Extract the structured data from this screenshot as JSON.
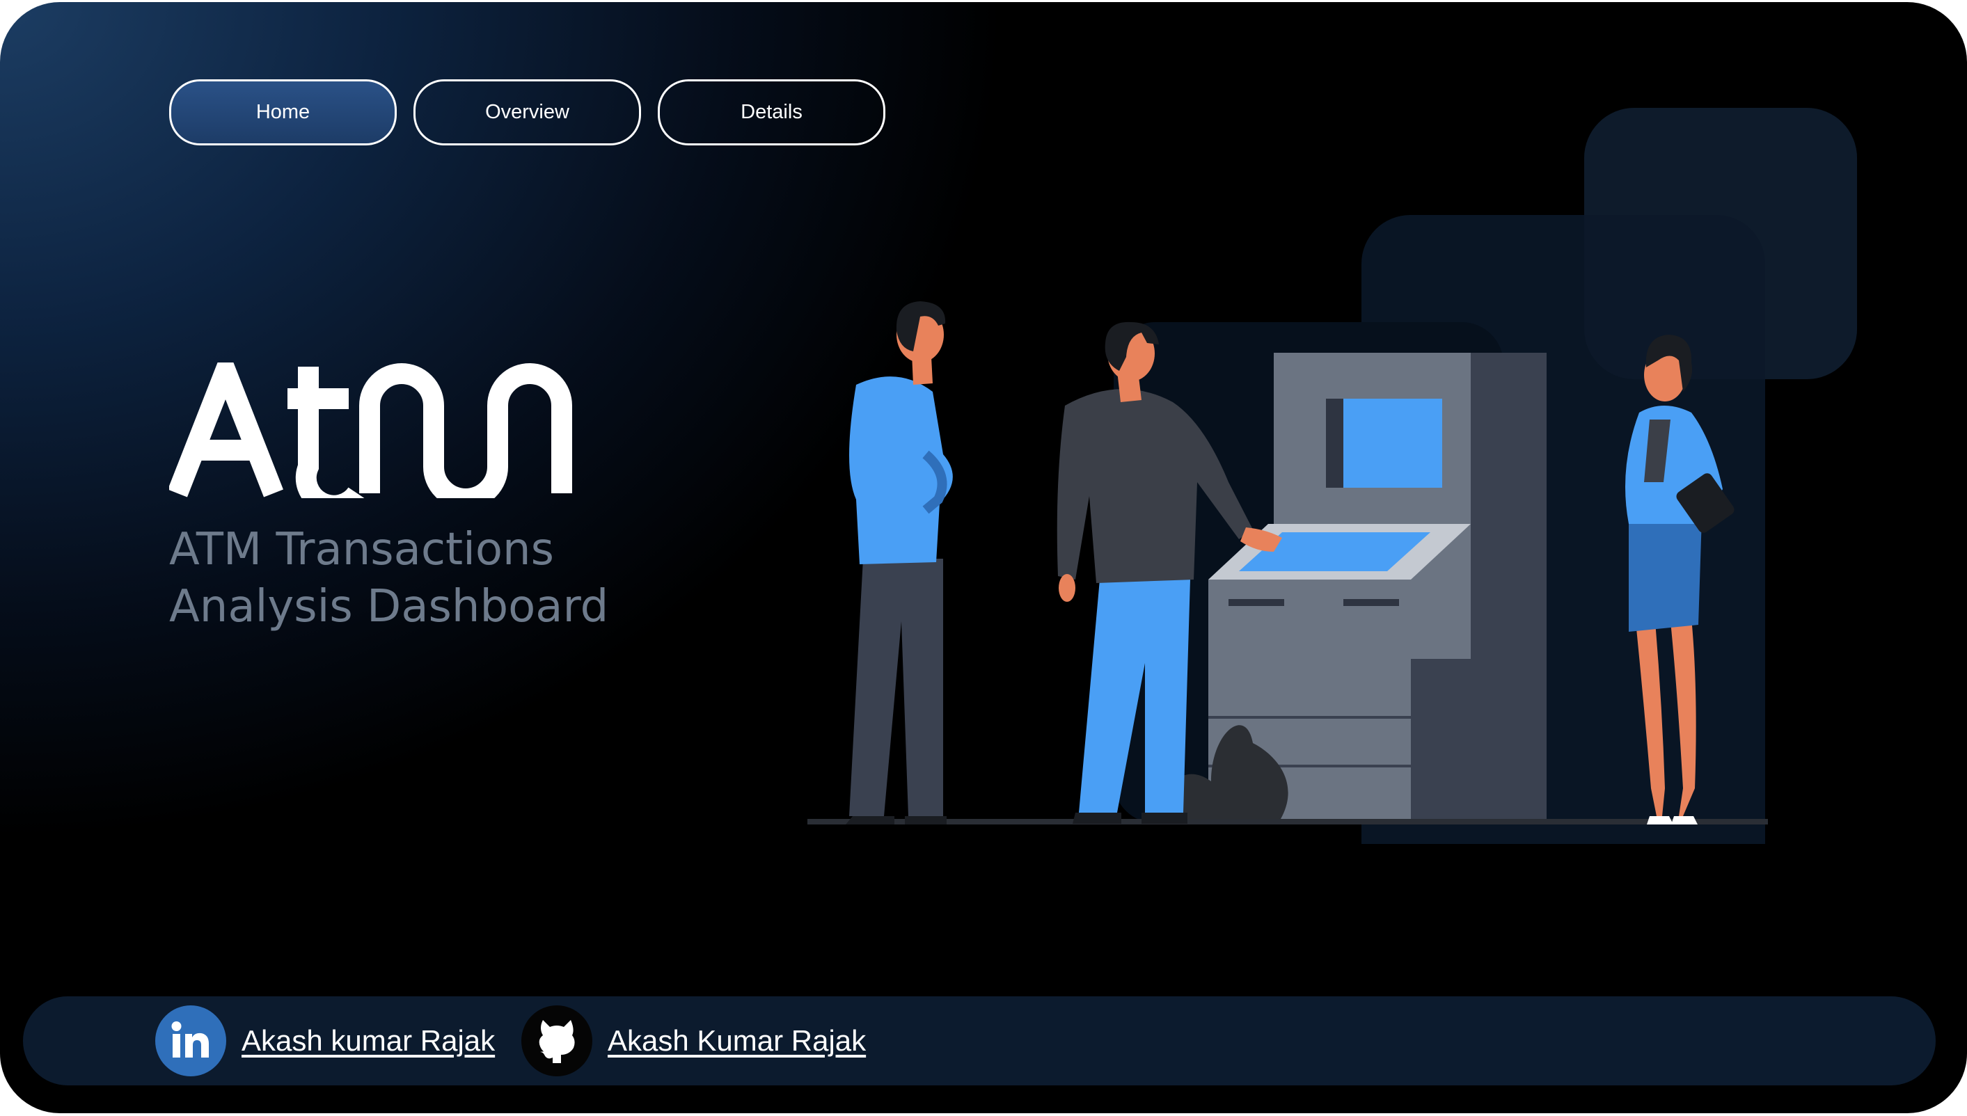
{
  "nav": {
    "buttons": [
      {
        "label": "Home",
        "active": true
      },
      {
        "label": "Overview",
        "active": false
      },
      {
        "label": "Details",
        "active": false
      }
    ]
  },
  "hero": {
    "logo_text": "ATM",
    "subtitle_line1": "ATM Transactions",
    "subtitle_line2": "Analysis Dashboard",
    "illustration": "people-at-atm-illustration"
  },
  "footer": {
    "linkedin": {
      "icon": "linkedin-icon",
      "label": "Akash kumar Rajak"
    },
    "github": {
      "icon": "github-icon",
      "label": "Akash Kumar Rajak"
    }
  },
  "colors": {
    "accent": "#4a9ff5",
    "accent_dark": "#2f6fba",
    "nav_active": "#2a5187",
    "footer_bg": "#0c1b2e",
    "subtitle": "#6e7b8c"
  }
}
